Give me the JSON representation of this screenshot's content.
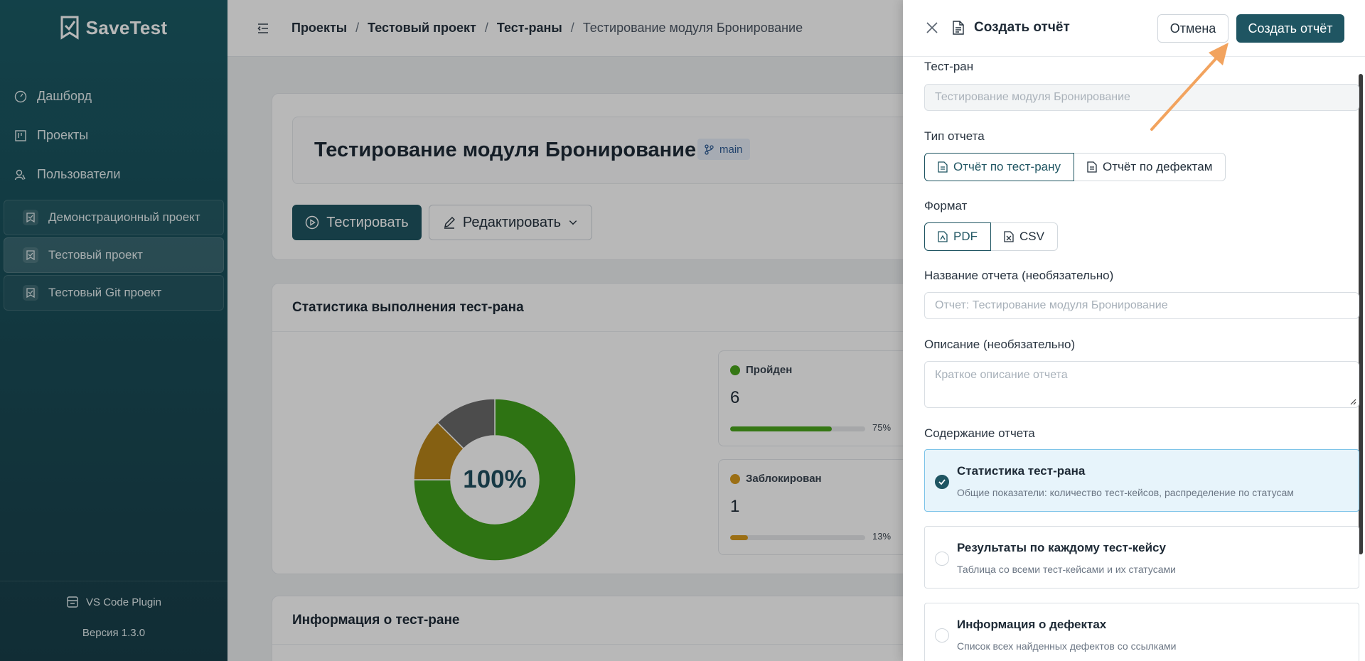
{
  "app": {
    "name": "SaveTest"
  },
  "sidebar": {
    "nav": [
      {
        "label": "Дашборд",
        "icon": "dashboard-icon"
      },
      {
        "label": "Проекты",
        "icon": "projects-icon"
      },
      {
        "label": "Пользователи",
        "icon": "users-icon"
      }
    ],
    "projects": [
      {
        "label": "Демонстрационный проект"
      },
      {
        "label": "Тестовый проект",
        "active": true
      },
      {
        "label": "Тестовый Git проект"
      }
    ],
    "plugin_label": "VS Code Plugin",
    "version": "Версия 1.3.0"
  },
  "breadcrumb": {
    "items": [
      "Проекты",
      "Тестовый проект",
      "Тест-раны"
    ],
    "current": "Тестирование модуля Бронирование",
    "separator": "/"
  },
  "run": {
    "title": "Тестирование модуля Бронирование",
    "branch": "main",
    "test_button": "Тестировать",
    "edit_button": "Редактировать"
  },
  "stats": {
    "header": "Статистика выполнения тест-рана",
    "center_label": "100%",
    "items": [
      {
        "label": "Пройден",
        "count": "6",
        "percent_label": "75%",
        "percent": 75,
        "color": "#4aa51c"
      },
      {
        "label": "Заблокирован",
        "count": "1",
        "percent_label": "13%",
        "percent": 13,
        "color": "#d79a1e"
      }
    ],
    "donut": [
      {
        "value": 75,
        "color": "#41a01b"
      },
      {
        "value": 12.5,
        "color": "#b98519"
      },
      {
        "value": 12.5,
        "color": "#6a6a6a"
      }
    ]
  },
  "info": {
    "header": "Информация о тест-ране"
  },
  "drawer": {
    "title": "Создать отчёт",
    "cancel": "Отмена",
    "create": "Создать отчёт",
    "testrun_label": "Тест-ран",
    "testrun_value": "Тестирование модуля Бронирование",
    "type_label": "Тип отчета",
    "type_options": [
      "Отчёт по тест-рану",
      "Отчёт по дефектам"
    ],
    "format_label": "Формат",
    "format_options": [
      "PDF",
      "CSV"
    ],
    "name_label": "Название отчета (необязательно)",
    "name_placeholder": "Отчет: Тестирование модуля Бронирование",
    "desc_label": "Описание (необязательно)",
    "desc_placeholder": "Краткое описание отчета",
    "content_label": "Содержание отчета",
    "content_options": [
      {
        "title": "Статистика тест-рана",
        "desc": "Общие показатели: количество тест-кейсов, распределение по статусам",
        "checked": true
      },
      {
        "title": "Результаты по каждому тест-кейсу",
        "desc": "Таблица со всеми тест-кейсами и их статусами",
        "checked": false
      },
      {
        "title": "Информация о дефектах",
        "desc": "Список всех найденных дефектов со ссылками",
        "checked": false
      }
    ]
  },
  "colors": {
    "accent": "#1f5562",
    "sidebar": "#1a4d58",
    "highlight_arrow": "#f2a35e"
  }
}
